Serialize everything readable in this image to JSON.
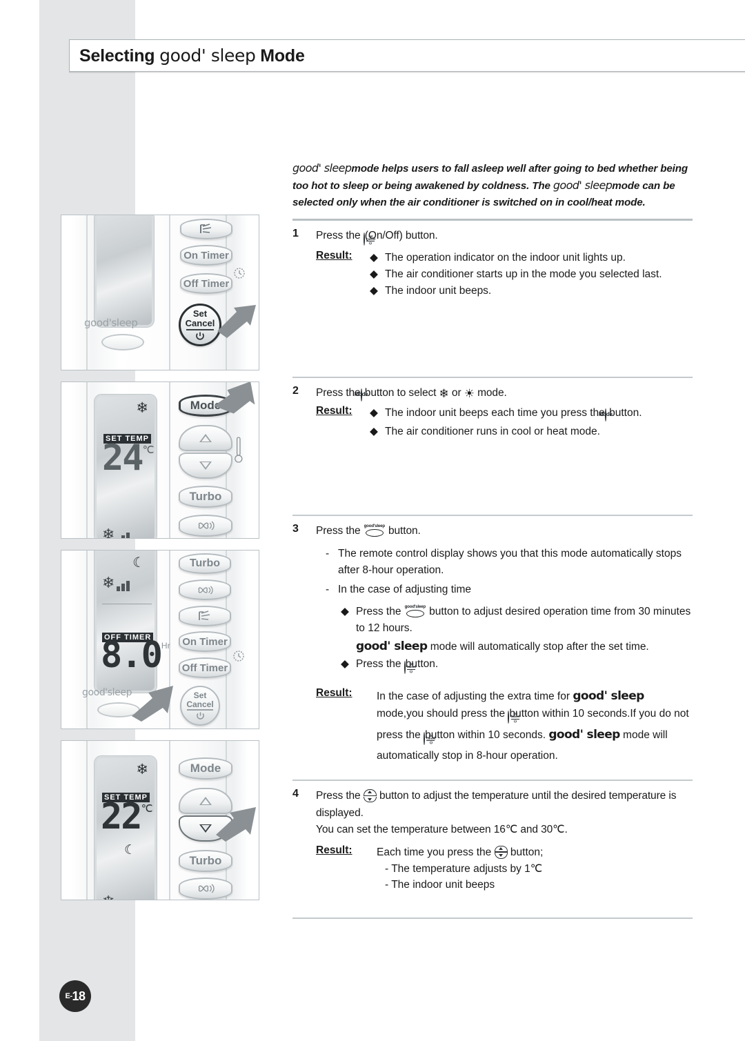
{
  "page": {
    "title_lead": "Selecting",
    "title_brand": "good' sleep",
    "title_tail": "Mode",
    "page_number": "E-18",
    "page_number_prefix": "E-",
    "page_number_value": "18"
  },
  "intro": {
    "brand": "good' sleep",
    "line1_rest": "mode helps users to fall asleep well after going to bed whether",
    "line2_a": "being too hot to sleep or being awakened by coldness. The",
    "line2_brand": "good' sleep",
    "line2_b": "mode can",
    "line3": "be selected only when the air conditioner is switched on in cool/heat mode."
  },
  "steps": [
    {
      "num": "1",
      "text_a": "Press the",
      "icon": "set-cancel-icon",
      "text_b": "(On/Off) button.",
      "result_label": "Result:",
      "results": [
        "The operation indicator on the indoor unit lights up.",
        "The air conditioner starts up in the mode you selected last.",
        "The indoor unit beeps."
      ]
    },
    {
      "num": "2",
      "text_a": "Press the",
      "icon": "mode-icon",
      "text_b": "button to select",
      "icon_cool": "snowflake-icon",
      "text_or": "or",
      "icon_heat": "sun-icon",
      "text_c": "mode.",
      "result_label": "Result:",
      "result1_a": "The indoor unit beeps each time you press the",
      "result1_b": "button.",
      "result2": "The air conditioner runs in cool or heat mode."
    },
    {
      "num": "3",
      "text_a": "Press the",
      "icon": "good-sleep-icon",
      "text_b": "button.",
      "dash1": "The remote control display shows you that this mode automatically stops after 8-hour operation.",
      "dash2": "In the case of adjusting time",
      "bullet1_a": "Press the",
      "bullet1_b": "button to adjust desired operation time from 30 minutes to 12 hours.",
      "note_brand": "good' sleep",
      "note_rest": "mode will automatically stop after the set time.",
      "bullet2_a": "Press the",
      "bullet2_b": "button.",
      "result_label": "Result:",
      "result_l1_a": "In the case of adjusting the extra time for",
      "result_l1_brand": "good' sleep",
      "result_l1_b": "mode,you",
      "result_l2_a": "should press the",
      "result_l2_b": "button within 10 seconds.If you do not press",
      "result_l3_a": "the",
      "result_l3_b": "button within 10 seconds.",
      "result_l3_brand": "good' sleep",
      "result_l3_c": "mode will",
      "result_l4": "automatically stop in 8-hour operation."
    },
    {
      "num": "4",
      "text_a": "Press the",
      "icon": "temp-updown-icon",
      "text_b": "button to adjust the temperature until the desired temperature is displayed.",
      "text_c": "You can set the temperature between 16℃ and 30℃.",
      "result_label": "Result:",
      "result_a": "Each time you press the",
      "result_b": "button;",
      "sub1": "- The temperature adjusts by 1℃",
      "sub2": "- The indoor unit beeps"
    }
  ],
  "illustrations": [
    {
      "name": "panel-step1",
      "buttons": [
        "On Timer",
        "Off Timer"
      ],
      "set_cancel_line1": "Set",
      "set_cancel_line2": "Cancel",
      "brand_label": "good'sleep",
      "icons": [
        "air-swing-icon",
        "timer-clock-icon",
        "power-icon"
      ],
      "cursor": "set-cancel-button"
    },
    {
      "name": "panel-step2",
      "buttons": [
        "Mode",
        "Turbo"
      ],
      "display": {
        "mode_icon": "snowflake-icon",
        "set_temp_label": "SET TEMP",
        "temperature": "24",
        "unit": "℃"
      },
      "icons": [
        "thermometer-icon",
        "fan-icon",
        "fan-speed-bars-icon"
      ],
      "cursor": "mode-button"
    },
    {
      "name": "panel-step3",
      "buttons": [
        "Turbo",
        "On Timer",
        "Off Timer"
      ],
      "set_cancel_line1": "Set",
      "set_cancel_line2": "Cancel",
      "brand_label": "good'sleep",
      "display": {
        "mode_icon": "moon-icon",
        "off_timer_label": "OFF TIMER",
        "timer_value": "8.0",
        "timer_unit": "Hr"
      },
      "icons": [
        "fan-icon",
        "air-swing-icon",
        "timer-clock-icon",
        "fan-speed-bars-icon"
      ],
      "cursor": "good-sleep-button"
    },
    {
      "name": "panel-step4",
      "buttons": [
        "Mode",
        "Turbo"
      ],
      "display": {
        "mode_icon": "snowflake-icon",
        "set_temp_label": "SET TEMP",
        "temperature": "22",
        "unit": "℃",
        "sleep_icon": "moon-icon"
      },
      "icons": [
        "fan-icon",
        "temp-up-arrow-icon",
        "temp-down-arrow-icon"
      ],
      "cursor": "temp-down-button"
    }
  ],
  "colors": {
    "band": "#e3e5e6",
    "rule": "#b9c0c4",
    "page_badge": "#2a2a2a",
    "text": "#1a1a1a"
  }
}
